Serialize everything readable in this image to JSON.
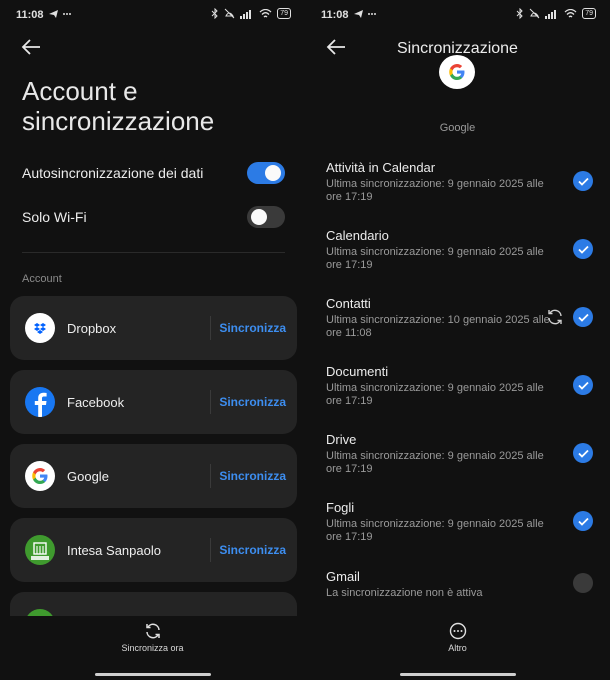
{
  "status_bar": {
    "time": "11:08",
    "battery": "79"
  },
  "left": {
    "title": "Account e sincronizzazione",
    "settings": [
      {
        "label": "Autosincronizzazione dei dati",
        "enabled": true
      },
      {
        "label": "Solo Wi-Fi",
        "enabled": false
      }
    ],
    "section_header": "Account",
    "accounts": [
      {
        "name": "Dropbox",
        "action": "Sincronizza",
        "icon": "dropbox-icon"
      },
      {
        "name": "Facebook",
        "action": "Sincronizza",
        "icon": "facebook-icon"
      },
      {
        "name": "Google",
        "action": "Sincronizza",
        "icon": "google-icon"
      },
      {
        "name": "Intesa Sanpaolo",
        "action": "Sincronizza",
        "icon": "intesa-sanpaolo-icon"
      }
    ],
    "bottom_action": "Sincronizza ora"
  },
  "right": {
    "title": "Sincronizzazione",
    "account_label": "Google",
    "items": [
      {
        "name": "Attività in Calendar",
        "status": "Ultima sincronizzazione: 9 gennaio 2025 alle ore 17:19",
        "checked": true
      },
      {
        "name": "Calendario",
        "status": "Ultima sincronizzazione: 9 gennaio 2025 alle ore 17:19",
        "checked": true
      },
      {
        "name": "Contatti",
        "status": "Ultima sincronizzazione: 10 gennaio 2025 alle ore 11:08",
        "checked": true,
        "syncing": true
      },
      {
        "name": "Documenti",
        "status": "Ultima sincronizzazione: 9 gennaio 2025 alle ore 17:19",
        "checked": true
      },
      {
        "name": "Drive",
        "status": "Ultima sincronizzazione: 9 gennaio 2025 alle ore 17:19",
        "checked": true
      },
      {
        "name": "Fogli",
        "status": "Ultima sincronizzazione: 9 gennaio 2025 alle ore 17:19",
        "checked": true
      },
      {
        "name": "Gmail",
        "status": "La sincronizzazione non è attiva",
        "checked": false
      }
    ],
    "bottom_action": "Altro"
  },
  "colors": {
    "accent": "#2c7be5",
    "link": "#3d8ef0",
    "card": "#242424",
    "background": "#111111"
  }
}
